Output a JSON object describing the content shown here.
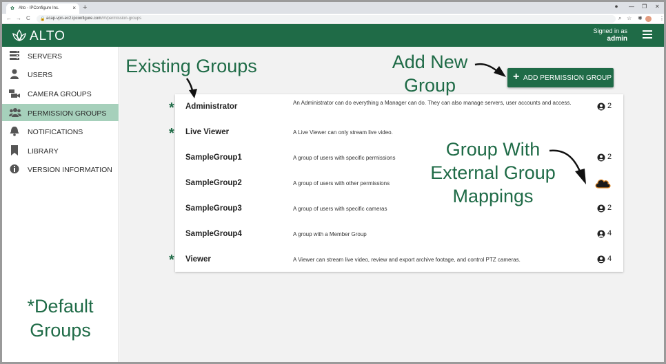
{
  "browser": {
    "tab_title": "Alto - IPConfigure Inc.",
    "tab_close": "×",
    "new_tab": "+",
    "url_host": "acap-vpn-ec2.ipconfigure.com",
    "url_path": "/#!/permission-groups",
    "minimize": "—",
    "maximize": "❐",
    "close": "✕",
    "back": "←",
    "forward": "→",
    "reload": "C"
  },
  "header": {
    "logo_text": "ALTO",
    "signed_in_label": "Signed in as",
    "username": "admin",
    "brand_color": "#1f6b47"
  },
  "sidebar": {
    "items": [
      {
        "label": "SERVERS",
        "icon": "server-icon"
      },
      {
        "label": "USERS",
        "icon": "user-icon"
      },
      {
        "label": "CAMERA GROUPS",
        "icon": "camera-icon"
      },
      {
        "label": "PERMISSION GROUPS",
        "icon": "group-icon",
        "active": true
      },
      {
        "label": "NOTIFICATIONS",
        "icon": "bell-icon"
      },
      {
        "label": "LIBRARY",
        "icon": "bookmark-icon"
      },
      {
        "label": "VERSION INFORMATION",
        "icon": "info-icon"
      }
    ],
    "default_note_line1": "*Default",
    "default_note_line2": "Groups"
  },
  "toolbar": {
    "add_button_label": "ADD PERMISSION GROUP",
    "add_button_icon": "+"
  },
  "groups": [
    {
      "name": "Administrator",
      "description": "An Administrator can do everything a Manager can do. They can also manage servers, user accounts and access.",
      "count": "2",
      "default": true
    },
    {
      "name": "Live Viewer",
      "description": "A Live Viewer can only stream live video.",
      "count": "",
      "default": true
    },
    {
      "name": "SampleGroup1",
      "description": "A group of users with specific permissions",
      "count": "2",
      "default": false
    },
    {
      "name": "SampleGroup2",
      "description": "A group of users with other permissions",
      "count": "",
      "default": false,
      "external_mapping": true
    },
    {
      "name": "SampleGroup3",
      "description": "A group of users with specific cameras",
      "count": "2",
      "default": false
    },
    {
      "name": "SampleGroup4",
      "description": "A group with a Member Group",
      "count": "4",
      "default": false
    },
    {
      "name": "Viewer",
      "description": "A Viewer can stream live video, review and export archive footage, and control PTZ cameras.",
      "count": "4",
      "default": true
    }
  ],
  "default_marker": "*",
  "annotations": {
    "existing_groups": "Existing Groups",
    "add_new_line1": "Add New",
    "add_new_line2": "Group",
    "external_line1": "Group With",
    "external_line2": "External Group",
    "external_line3": "Mappings"
  }
}
